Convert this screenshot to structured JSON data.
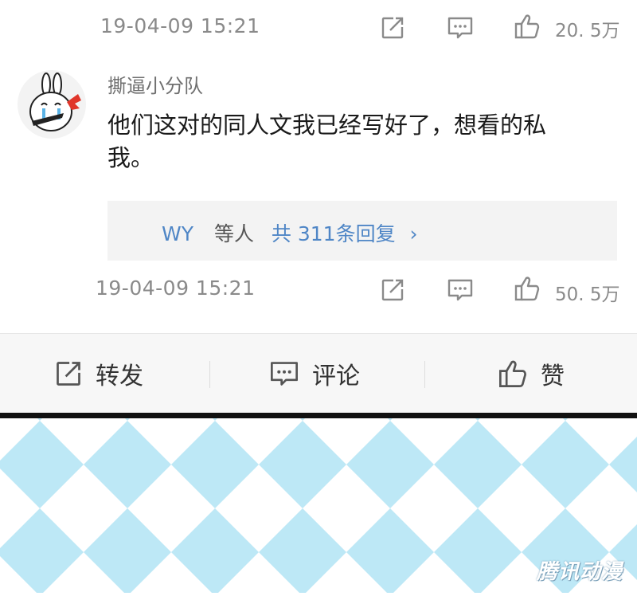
{
  "top_meta": {
    "timestamp": "19-04-09 15:21",
    "likes": "20. 5万"
  },
  "comment": {
    "username": "撕逼小分队",
    "text_line1": "他们这对的同人文我已经写好了，想看的私",
    "text_line2": "我。",
    "replies": {
      "user": "WY",
      "mid": "等人",
      "count_text": "共 311条回复",
      "chevron": "›"
    },
    "timestamp": "19-04-09 15:21",
    "likes": "50. 5万"
  },
  "actions": {
    "repost": "转发",
    "comment": "评论",
    "like": "赞"
  },
  "watermark": "腾讯动漫",
  "icons": {
    "share": "share-icon",
    "comment": "comment-icon",
    "like": "thumbs-up-icon",
    "avatar": "bunny-avatar-icon"
  },
  "colors": {
    "link_blue": "#4f86c6",
    "pattern_blue": "#bde8f6",
    "bar_bg": "#f7f7f7"
  }
}
